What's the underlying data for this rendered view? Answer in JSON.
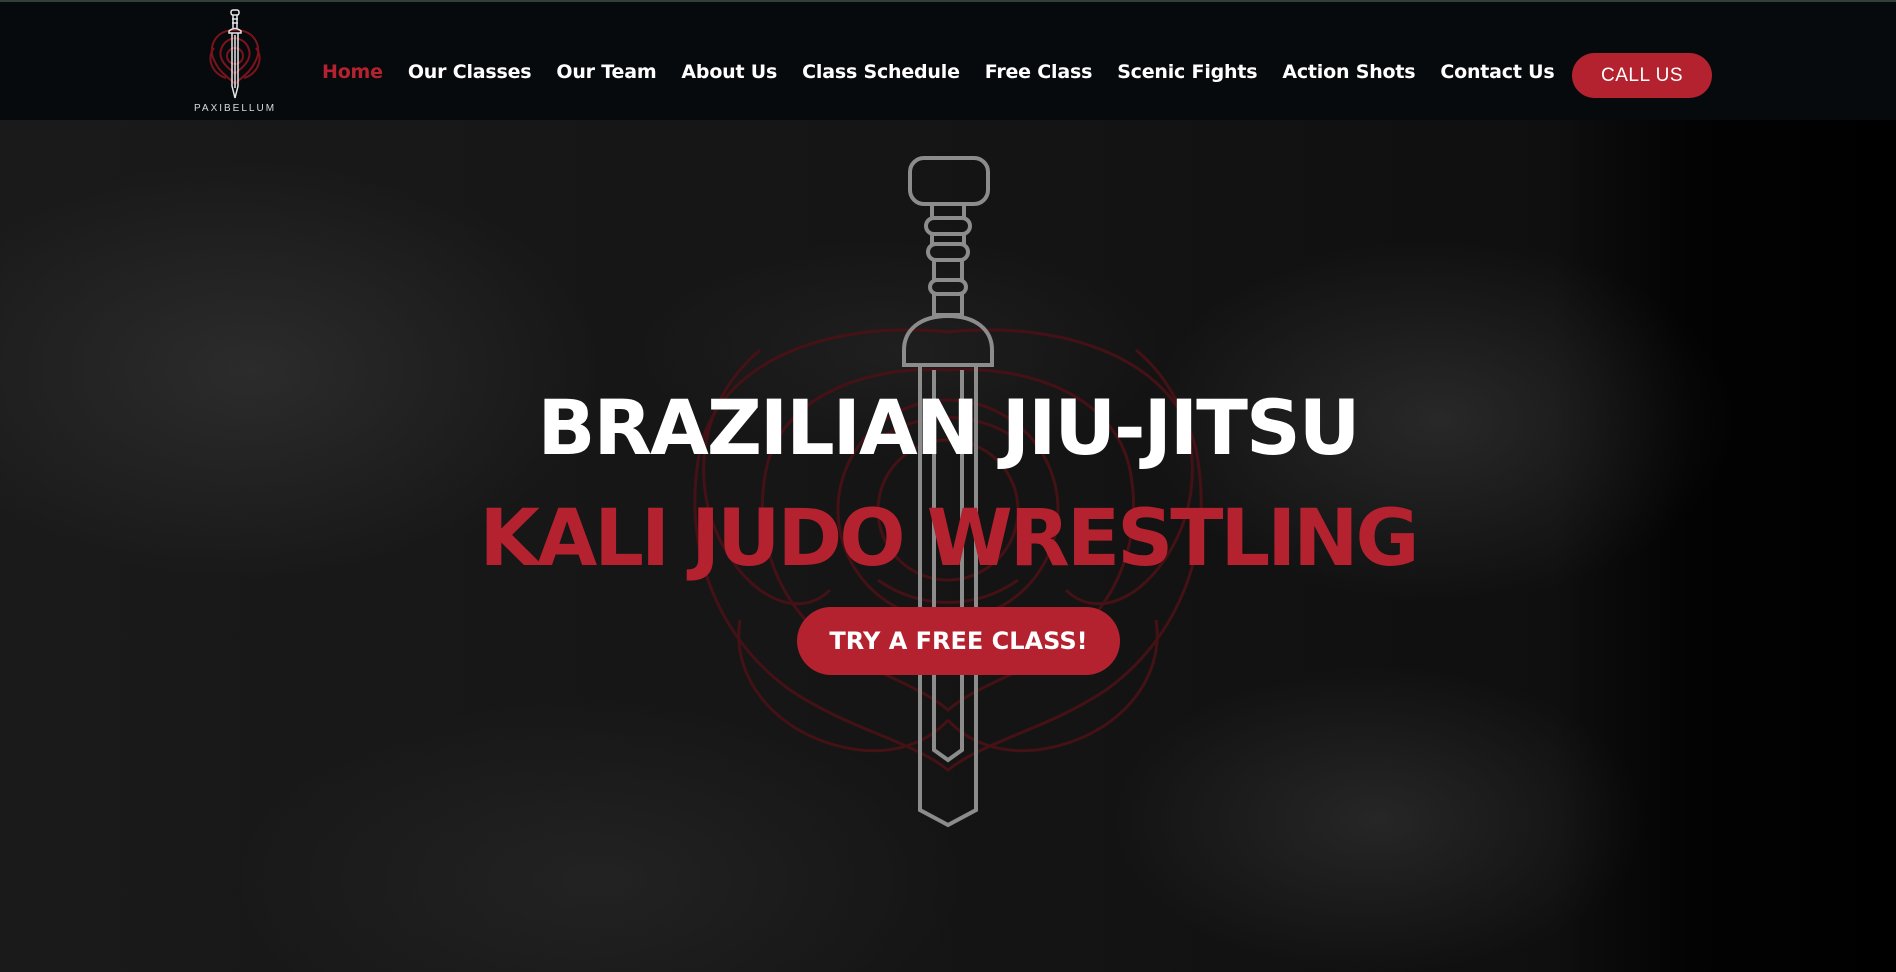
{
  "header": {
    "logo_text": "PAXIBELLUM",
    "nav": [
      {
        "label": "Home",
        "active": true
      },
      {
        "label": "Our Classes"
      },
      {
        "label": "Our Team"
      },
      {
        "label": "About Us"
      },
      {
        "label": "Class Schedule"
      },
      {
        "label": "Free Class"
      },
      {
        "label": "Scenic Fights"
      },
      {
        "label": "Action Shots"
      },
      {
        "label": "Contact Us"
      }
    ],
    "call_label": "CALL US"
  },
  "hero": {
    "title": "BRAZILIAN JIU-JITSU",
    "subtitle": "KALI JUDO WRESTLING",
    "cta_label": "TRY A FREE CLASS!"
  },
  "colors": {
    "accent": "#b5222f",
    "header_bg": "#070a0d",
    "text": "#ffffff"
  },
  "icons": {
    "logo": "sword-rose-emblem-icon",
    "hero_emblem": "sword-rose-emblem-icon"
  }
}
